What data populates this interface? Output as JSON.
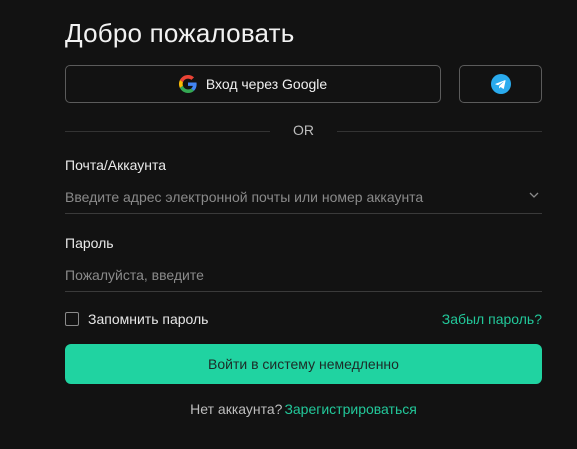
{
  "title": "Добро пожаловать",
  "social": {
    "google_label": "Вход через Google",
    "google_icon": "google-g-icon",
    "telegram_icon": "telegram-icon",
    "telegram_color": "#2AABEE"
  },
  "divider_text": "OR",
  "account": {
    "label": "Почта/Аккаунта",
    "placeholder": "Введите адрес электронной почты или номер аккаунта",
    "value": ""
  },
  "password": {
    "label": "Пароль",
    "placeholder": "Пожалуйста, введите",
    "value": ""
  },
  "remember": {
    "label": "Запомнить пароль",
    "checked": false
  },
  "forgot_link": "Забыл пароль?",
  "login_button": "Войти в систему немедленно",
  "signup": {
    "question": "Нет аккаунта?",
    "link": "Зарегистрироваться"
  },
  "colors": {
    "background": "#121212",
    "accent": "#20d3a1",
    "link": "#22c89a"
  }
}
